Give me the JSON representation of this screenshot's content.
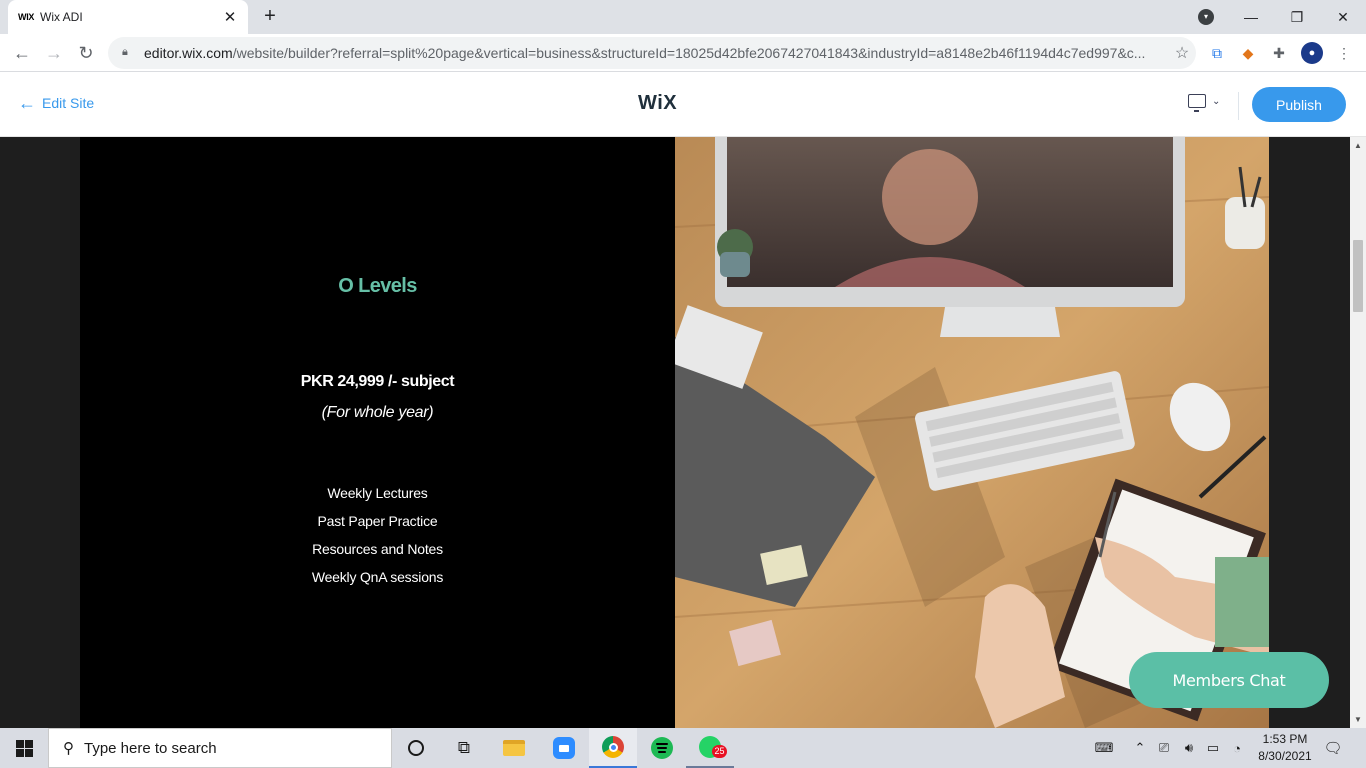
{
  "browser": {
    "tab_title": "Wix ADI",
    "tab_favicon_text": "WIX",
    "url_host": "editor.wix.com",
    "url_path": "/website/builder?referral=split%20page&vertical=business&structureId=18025d42bfe2067427041843&industryId=a8148e2b46f1194d4c7ed997&c..."
  },
  "editor": {
    "back_label": "Edit Site",
    "logo_text": "WiX",
    "publish_label": "Publish"
  },
  "course": {
    "title": "O Levels",
    "price": "PKR 24,999 /- subject",
    "duration": "(For whole year)",
    "features": [
      "Weekly Lectures",
      "Past Paper Practice",
      "Resources and Notes",
      "Weekly QnA sessions"
    ]
  },
  "chat": {
    "label": "Members Chat"
  },
  "taskbar": {
    "search_placeholder": "Type here to search",
    "whatsapp_badge": "25",
    "time": "1:53 PM",
    "date": "8/30/2021"
  },
  "colors": {
    "accent_teal": "#66bfa6",
    "wix_blue": "#3899ec",
    "chat_button": "#5bbfa6"
  }
}
